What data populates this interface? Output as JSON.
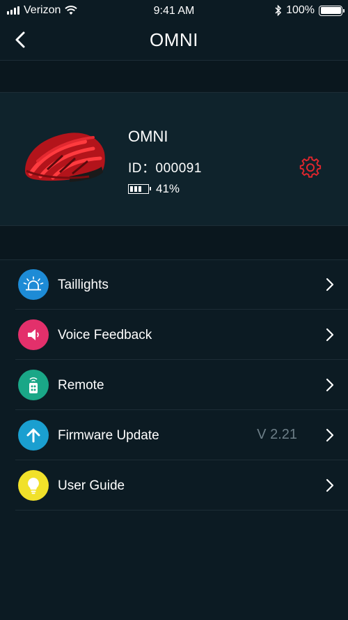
{
  "status_bar": {
    "carrier": "Verizon",
    "time": "9:41 AM",
    "battery": "100%"
  },
  "nav": {
    "title": "OMNI"
  },
  "device": {
    "name": "OMNI",
    "id": "ID：000091",
    "battery": "41%",
    "battery_level": 0.41
  },
  "menu": {
    "items": [
      {
        "label": "Taillights",
        "value": "",
        "icon": "taillight-icon",
        "color": "#1d8bd6"
      },
      {
        "label": "Voice Feedback",
        "value": "",
        "icon": "speaker-icon",
        "color": "#e3306b"
      },
      {
        "label": "Remote",
        "value": "",
        "icon": "remote-icon",
        "color": "#1aa787"
      },
      {
        "label": "Firmware Update",
        "value": "V 2.21",
        "icon": "upload-arrow-icon",
        "color": "#1a9fd0"
      },
      {
        "label": "User Guide",
        "value": "",
        "icon": "lightbulb-icon",
        "color": "#f1e12a"
      }
    ]
  },
  "colors": {
    "background": "#0c1b23",
    "card": "#0f232c",
    "accent_red": "#e1262d"
  }
}
